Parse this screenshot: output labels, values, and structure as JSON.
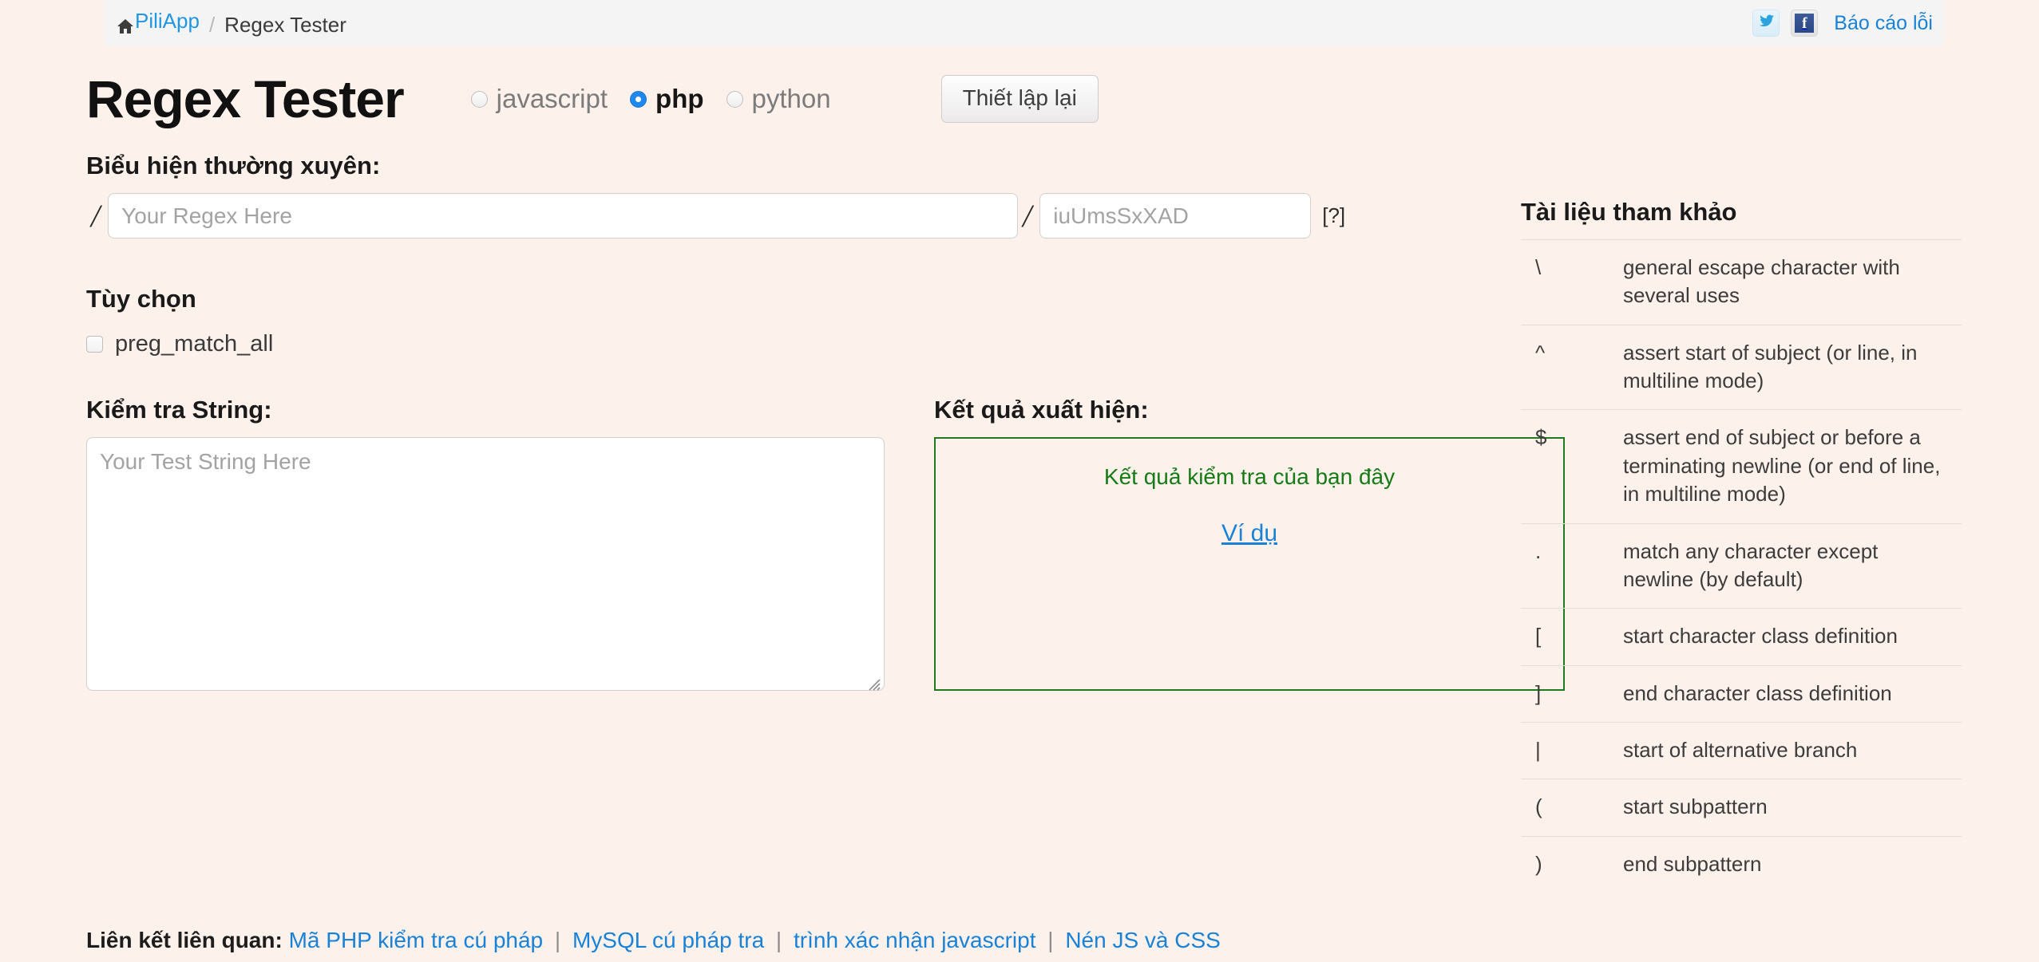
{
  "header": {
    "home_label": "PiliApp",
    "home_icon": "home-icon",
    "separator": "/",
    "current": "Regex Tester",
    "twitter_icon": "twitter-icon",
    "facebook_icon": "facebook-icon",
    "facebook_glyph": "f",
    "report_link": "Báo cáo lỗi"
  },
  "main": {
    "title": "Regex Tester",
    "engines": [
      {
        "label": "javascript",
        "selected": false
      },
      {
        "label": "php",
        "selected": true
      },
      {
        "label": "python",
        "selected": false
      }
    ],
    "reset_button": "Thiết lập lại",
    "regex_label": "Biểu hiện thường xuyên:",
    "slash": "/",
    "regex_placeholder": "Your Regex Here",
    "regex_value": "",
    "flags_placeholder": "iuUmsSxXAD",
    "flags_value": "",
    "help_link": "[?]",
    "options_label": "Tùy chọn",
    "options": [
      {
        "label": "preg_match_all",
        "checked": false
      }
    ],
    "test_label": "Kiểm tra String:",
    "test_placeholder": "Your Test String Here",
    "test_value": "",
    "result_label": "Kết quả xuất hiện:",
    "result_text": "Kết quả kiểm tra của bạn đây",
    "example_link": "Ví dụ"
  },
  "sidebar": {
    "title": "Tài liệu tham khảo",
    "rows": [
      {
        "symbol": "\\",
        "description": "general escape character with several uses"
      },
      {
        "symbol": "^",
        "description": "assert start of subject (or line, in multiline mode)"
      },
      {
        "symbol": "$",
        "description": "assert end of subject or before a terminating newline (or end of line, in multiline mode)"
      },
      {
        "symbol": ".",
        "description": "match any character except newline (by default)"
      },
      {
        "symbol": "[",
        "description": "start character class definition"
      },
      {
        "symbol": "]",
        "description": "end character class definition"
      },
      {
        "symbol": "|",
        "description": "start of alternative branch"
      },
      {
        "symbol": "(",
        "description": "start subpattern"
      },
      {
        "symbol": ")",
        "description": "end subpattern"
      }
    ]
  },
  "footer": {
    "label": "Liên kết liên quan:",
    "separator": "|",
    "links": [
      "Mã PHP kiểm tra cú pháp",
      "MySQL cú pháp tra",
      "trình xác nhận javascript",
      "Nén JS và CSS"
    ]
  },
  "colors": {
    "page_background": "#fdf1ec",
    "breadcrumb_background": "#f4f4f4",
    "link_blue": "#1a82d6",
    "accent_blue": "#1e88f0",
    "result_green": "#167a16",
    "result_border": "#1f7a1f"
  }
}
